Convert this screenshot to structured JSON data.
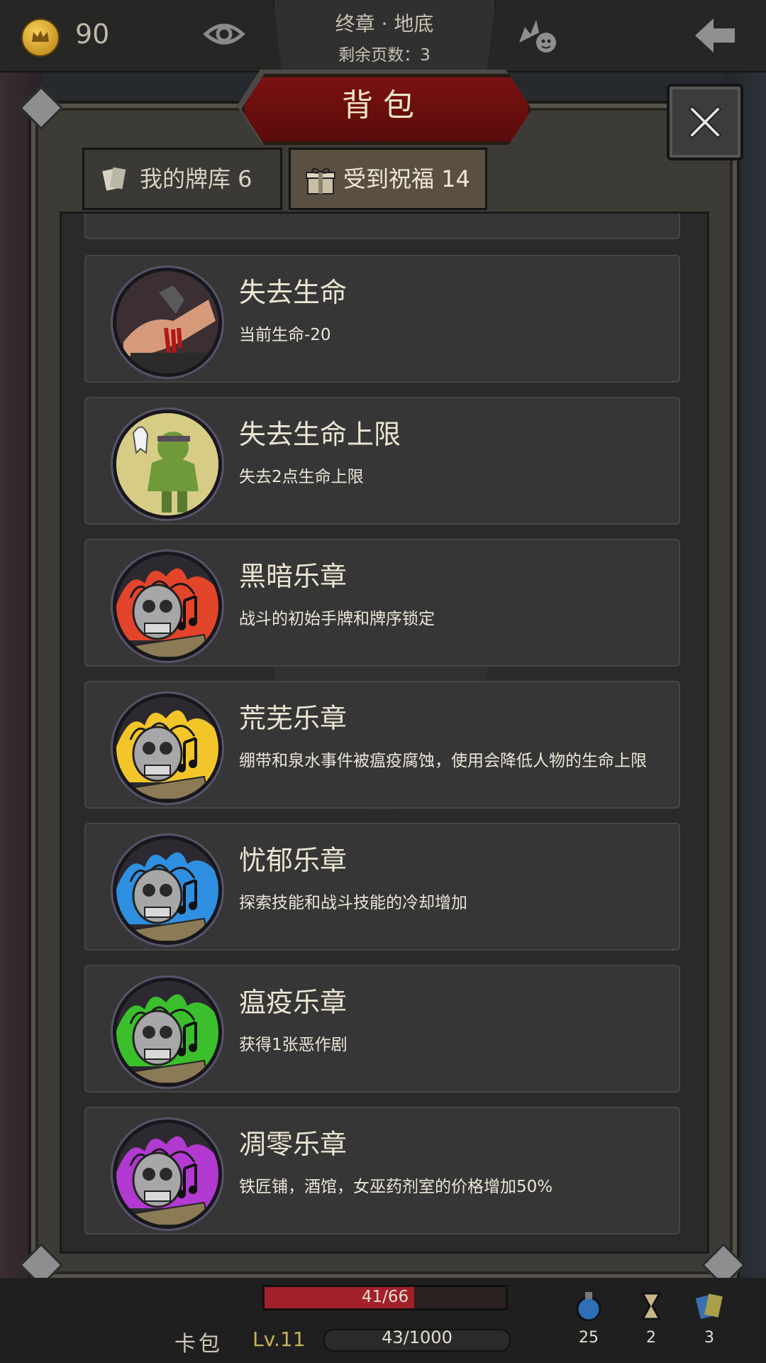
{
  "topbar": {
    "coins": "90",
    "chapter_title": "终章 · 地底",
    "pages_remaining": "剩余页数：3"
  },
  "modal": {
    "title": "背包",
    "tabs": [
      {
        "label": "我的牌库 6",
        "selected": false
      },
      {
        "label": "受到祝福 14",
        "selected": true
      }
    ]
  },
  "blessings": [
    {
      "title": "失去生命",
      "desc": "当前生命-20",
      "icon": "bleeding-arm-icon"
    },
    {
      "title": "失去生命上限",
      "desc": "失去2点生命上限",
      "icon": "ghoul-icon"
    },
    {
      "title": "黑暗乐章",
      "desc": "战斗的初始手牌和牌序锁定",
      "icon": "skull-music-red-icon",
      "accent": "#e3452b"
    },
    {
      "title": "荒芜乐章",
      "desc": "绷带和泉水事件被瘟疫腐蚀，使用会降低人物的生命上限",
      "icon": "skull-music-yellow-icon",
      "accent": "#f2c52a"
    },
    {
      "title": "忧郁乐章",
      "desc": "探索技能和战斗技能的冷却增加",
      "icon": "skull-music-blue-icon",
      "accent": "#2f8fe0"
    },
    {
      "title": "瘟疫乐章",
      "desc": "获得1张恶作剧",
      "icon": "skull-music-green-icon",
      "accent": "#3bbf2d"
    },
    {
      "title": "凋零乐章",
      "desc": "铁匠铺，酒馆，女巫药剂室的价格增加50%",
      "icon": "skull-music-purple-icon",
      "accent": "#b23ad0"
    }
  ],
  "bottombar": {
    "card_pack_label": "卡包",
    "hp_text": "41/66",
    "hp_fraction": 0.62,
    "level": "Lv.11",
    "xp_text": "43/1000",
    "potions": "25",
    "hourglass": "2",
    "cards": "3"
  }
}
